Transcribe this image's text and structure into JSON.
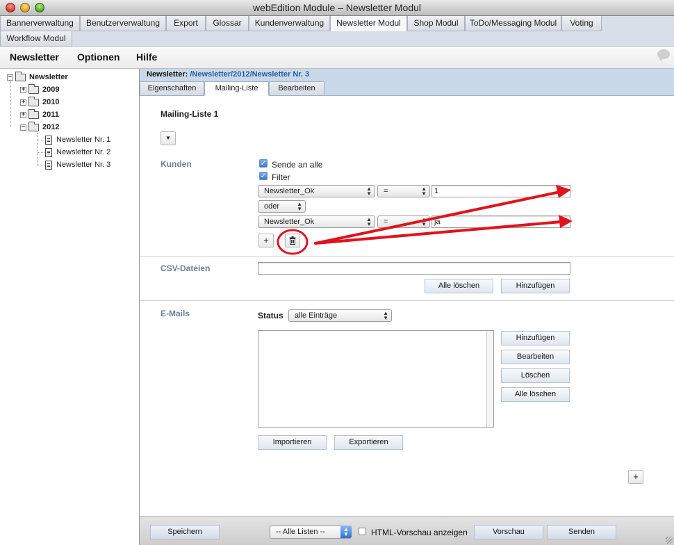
{
  "window": {
    "title": "webEdition Module – Newsletter Modul"
  },
  "module_tabs": [
    {
      "label": "Bannerverwaltung",
      "active": false
    },
    {
      "label": "Benutzerverwaltung",
      "active": false
    },
    {
      "label": "Export",
      "active": false
    },
    {
      "label": "Glossar",
      "active": false
    },
    {
      "label": "Kundenverwaltung",
      "active": false
    },
    {
      "label": "Newsletter Modul",
      "active": true
    },
    {
      "label": "Shop Modul",
      "active": false
    },
    {
      "label": "ToDo/Messaging Modul",
      "active": false
    },
    {
      "label": "Voting",
      "active": false
    },
    {
      "label": "Workflow Modul",
      "active": false
    }
  ],
  "menu": {
    "items": [
      "Newsletter",
      "Optionen",
      "Hilfe"
    ]
  },
  "tree": {
    "root": "Newsletter",
    "years": [
      "2009",
      "2010",
      "2011",
      "2012"
    ],
    "toggles": {
      "collapsed": "+",
      "expanded": "−"
    },
    "items": [
      "Newsletter Nr. 1",
      "Newsletter Nr. 2",
      "Newsletter Nr. 3"
    ]
  },
  "path": {
    "label": "Newsletter:",
    "value": "/Newsletter/2012/Newsletter Nr. 3"
  },
  "sub_tabs": [
    {
      "label": "Eigenschaften",
      "active": false
    },
    {
      "label": "Mailing-Liste",
      "active": true
    },
    {
      "label": "Bearbeiten",
      "active": false
    }
  ],
  "mailing": {
    "title": "Mailing-Liste 1",
    "dropdown_icon": "▼",
    "kunden": {
      "label": "Kunden",
      "send_all": {
        "label": "Sende an alle",
        "checked": true
      },
      "filter": {
        "label": "Filter",
        "checked": true
      },
      "filters": [
        {
          "field": "Newsletter_Ok",
          "op": "=",
          "value": "1"
        },
        {
          "field": "Newsletter_Ok",
          "op": "=",
          "value": "ja"
        }
      ],
      "connector": "oder",
      "add_symbol": "+",
      "delete_icon": "trash-icon"
    },
    "csv": {
      "label": "CSV-Dateien",
      "value": "",
      "clear_all": "Alle löschen",
      "add": "Hinzufügen"
    },
    "emails": {
      "label": "E-Mails",
      "status_label": "Status",
      "status_value": "alle Einträge",
      "buttons": [
        "Hinzufügen",
        "Bearbeiten",
        "Löschen",
        "Alle löschen"
      ],
      "import": "Importieren",
      "export": "Exportieren"
    },
    "add_list_symbol": "+"
  },
  "footer": {
    "save": "Speichern",
    "list_select": "-- Alle Listen --",
    "html_preview": {
      "label": "HTML-Vorschau anzeigen",
      "checked": false
    },
    "preview": "Vorschau",
    "send": "Senden"
  },
  "colors": {
    "annotation_red": "#e0141e",
    "accent_blue": "#2a5b9b",
    "section_label": "#6d7f96",
    "path_bar": "#c9d9ea"
  }
}
